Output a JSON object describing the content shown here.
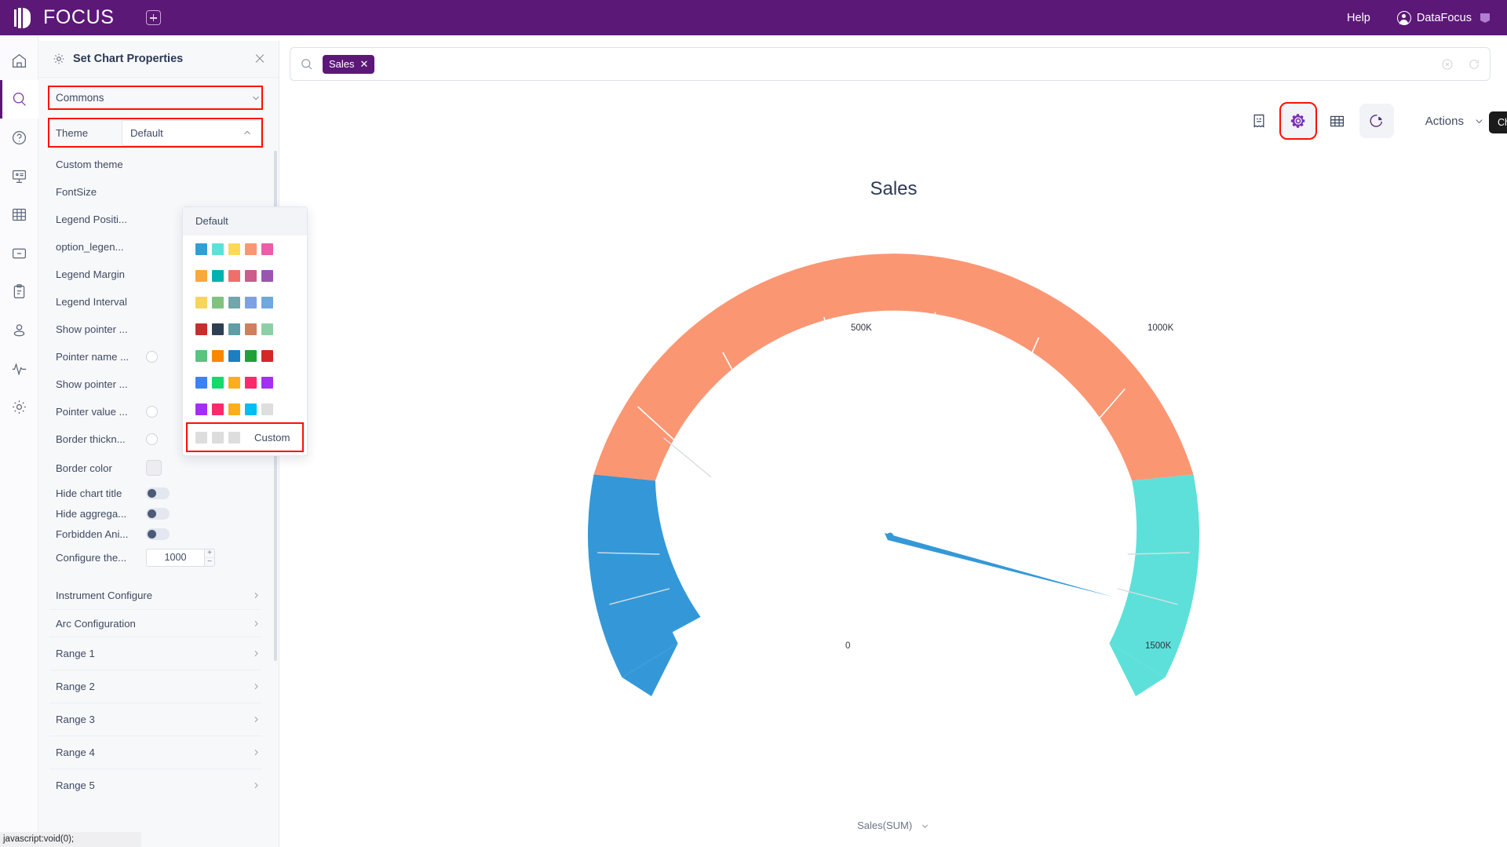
{
  "topbar": {
    "brand": "FOCUS",
    "add_tab_icon": "plus-square-icon",
    "help": "Help",
    "user": "DataFocus",
    "user_icon": "user-circle-icon",
    "ribbon_icon": "ribbon-icon"
  },
  "rail": {
    "items": [
      {
        "name": "home",
        "icon": "home-icon",
        "active": false
      },
      {
        "name": "search",
        "icon": "search-icon",
        "active": true
      },
      {
        "name": "help",
        "icon": "question-circle-icon",
        "active": false
      },
      {
        "name": "presentation",
        "icon": "presentation-icon",
        "active": false
      },
      {
        "name": "table",
        "icon": "grid-table-icon",
        "active": false
      },
      {
        "name": "folder",
        "icon": "folder-minus-icon",
        "active": false
      },
      {
        "name": "clipboard",
        "icon": "clipboard-icon",
        "active": false
      },
      {
        "name": "user",
        "icon": "user-icon",
        "active": false
      },
      {
        "name": "monitor",
        "icon": "pulse-icon",
        "active": false
      },
      {
        "name": "settings",
        "icon": "gear-icon",
        "active": false
      }
    ]
  },
  "panel": {
    "icon": "gear-icon",
    "title": "Set Chart Properties",
    "close_icon": "close-icon",
    "group": {
      "label": "Commons",
      "chevron": "chevron-down-icon",
      "highlighted": true
    },
    "theme": {
      "label": "Theme",
      "value": "Default",
      "chevron": "chevron-up-icon",
      "highlighted": true
    },
    "options": [
      {
        "label": "Custom theme",
        "control": "none"
      },
      {
        "label": "FontSize",
        "control": "none"
      },
      {
        "label": "Legend Positi...",
        "control": "none"
      },
      {
        "label": "option_legen...",
        "control": "none"
      },
      {
        "label": "Legend Margin",
        "control": "none"
      },
      {
        "label": "Legend Interval",
        "control": "none"
      },
      {
        "label": "Show pointer ...",
        "control": "none"
      },
      {
        "label": "Pointer name ...",
        "control": "circle"
      },
      {
        "label": "Show pointer ...",
        "control": "none"
      },
      {
        "label": "Pointer value ...",
        "control": "circle"
      },
      {
        "label": "Border thickn...",
        "control": "circle"
      },
      {
        "label": "Border color",
        "control": "swatch"
      },
      {
        "label": "Hide chart title",
        "control": "toggle"
      },
      {
        "label": "Hide aggrega...",
        "control": "toggle"
      },
      {
        "label": "Forbidden Ani...",
        "control": "toggle"
      },
      {
        "label": "Configure the...",
        "control": "number",
        "value": "1000"
      }
    ],
    "sections": [
      {
        "label": "Instrument Configure",
        "chevron": "chevron-right-icon"
      },
      {
        "label": "Arc Configuration",
        "chevron": "chevron-right-icon"
      },
      {
        "label": "Range 1",
        "chevron": "chevron-right-icon"
      },
      {
        "label": "Range 2",
        "chevron": "chevron-right-icon"
      },
      {
        "label": "Range 3",
        "chevron": "chevron-right-icon"
      },
      {
        "label": "Range 4",
        "chevron": "chevron-right-icon"
      },
      {
        "label": "Range 5",
        "chevron": "chevron-right-icon"
      }
    ]
  },
  "theme_dropdown": {
    "header": "Default",
    "custom_label": "Custom",
    "custom_highlighted": true,
    "palettes": [
      [
        "#2f9fd6",
        "#5de0da",
        "#fcd85b",
        "#fb9673",
        "#e95fa8"
      ],
      [
        "#f8a83c",
        "#00b3b0",
        "#ef6f6c",
        "#cb5c8b",
        "#9a55ae"
      ],
      [
        "#f7d55c",
        "#81c281",
        "#71a6ac",
        "#7da2e2",
        "#6fa8dc"
      ],
      [
        "#c4302e",
        "#2f3f52",
        "#5f9ea5",
        "#d07f5f",
        "#8ecfa8"
      ],
      [
        "#58c47f",
        "#fb8700",
        "#1d7fc0",
        "#20a038",
        "#d42828"
      ],
      [
        "#3d82f5",
        "#14d96b",
        "#fcae1d",
        "#fb2a6a",
        "#a52ef5"
      ],
      [
        "#a52ef5",
        "#fb2a6a",
        "#fcae1d",
        "#00bdf5",
        "#dedede"
      ]
    ],
    "custom_swatches": [
      "#dddddd",
      "#dddddd",
      "#dddddd"
    ]
  },
  "search": {
    "icon": "search-icon",
    "chip": "Sales",
    "chip_close_icon": "close-icon",
    "clear_icon": "clear-circle-icon",
    "refresh_icon": "refresh-icon"
  },
  "toolbar": {
    "tooltip": "Chart Configurations",
    "buttons": [
      {
        "name": "receipt-icon",
        "filled": false,
        "selected": false
      },
      {
        "name": "gear-icon",
        "filled": true,
        "selected": true
      },
      {
        "name": "table-icon",
        "filled": false,
        "selected": false
      },
      {
        "name": "pie-chart-icon",
        "filled": true,
        "selected": false
      }
    ],
    "actions_label": "Actions",
    "actions_chevron": "chevron-down-icon"
  },
  "chart_data": {
    "type": "gauge",
    "title": "Sales",
    "legend": "Sales(SUM)",
    "legend_chevron": "chevron-down-icon",
    "min": 0,
    "max": 2000000,
    "tick_labels": [
      "0",
      "500K",
      "1000K",
      "1500K"
    ],
    "tick_values": [
      0,
      500000,
      1000000,
      1500000
    ],
    "pointer_value": 1250000,
    "bands": [
      {
        "from": 0,
        "to": 500000,
        "color": "#3498d8"
      },
      {
        "from": 500000,
        "to": 1000000,
        "color": "#fb9673"
      },
      {
        "from": 1000000,
        "to": 2000000,
        "color": "#5de0da"
      }
    ],
    "pointer_color": "#3498d8",
    "start_angle": 225,
    "end_angle": -45
  },
  "statusbar": {
    "text": "javascript:void(0);"
  }
}
